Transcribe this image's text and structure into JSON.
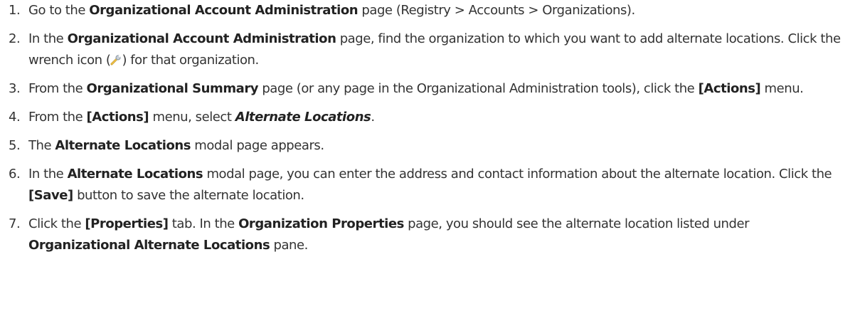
{
  "steps": [
    {
      "number": "1.",
      "parts": [
        "Go to the ",
        "Organizational Account Administration",
        " page (Registry > Accounts > Organizations)."
      ]
    },
    {
      "number": "2.",
      "parts": [
        "In the ",
        "Organizational Account Administration",
        " page, find the organization to which you want to add alternate locations. Click the wrench icon (",
        ") for that organization."
      ],
      "icon": "wrench-icon"
    },
    {
      "number": "3.",
      "parts": [
        "From the ",
        "Organizational Summary",
        " page (or any page in the Organizational Administration tools), click the ",
        "[Actions]",
        " menu."
      ]
    },
    {
      "number": "4.",
      "parts": [
        "From the ",
        "[Actions]",
        " menu, select ",
        "Alternate Locations",
        "."
      ]
    },
    {
      "number": "5.",
      "parts": [
        "The ",
        "Alternate Locations",
        " modal page appears."
      ]
    },
    {
      "number": "6.",
      "parts": [
        "In the ",
        "Alternate Locations",
        " modal page, you can enter the address and contact information about the alternate location. Click the ",
        "[Save]",
        " button to save the alternate location."
      ]
    },
    {
      "number": "7.",
      "parts": [
        "Click the ",
        "[Properties]",
        " tab. In the ",
        "Organization Properties",
        " page, you should see the alternate location listed under ",
        "Organizational Alternate Locations",
        " pane."
      ]
    }
  ]
}
